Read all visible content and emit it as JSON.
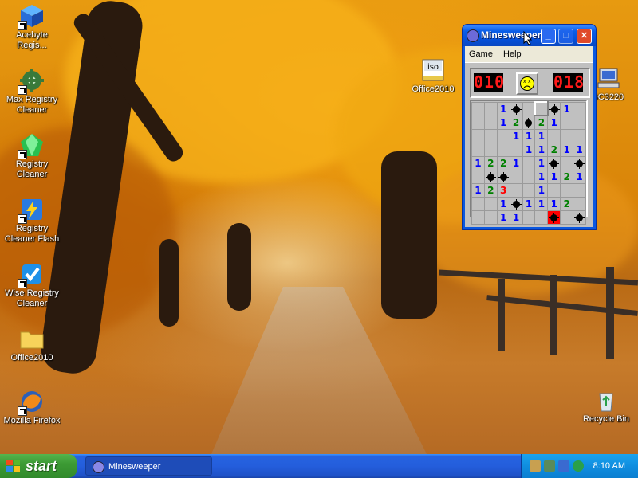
{
  "desktop": {
    "icons": [
      {
        "label": "Acebyte Regis...",
        "icon": "registry-cube-icon"
      },
      {
        "label": "Max Registry Cleaner",
        "icon": "gear-registry-icon"
      },
      {
        "label": "Registry Cleaner",
        "icon": "green-gem-icon"
      },
      {
        "label": "Registry Cleaner Flash",
        "icon": "flash-cube-icon"
      },
      {
        "label": "Wise Registry Cleaner",
        "icon": "wise-registry-icon"
      },
      {
        "label": "Office2010",
        "icon": "folder-icon"
      },
      {
        "label": "Mozilla Firefox",
        "icon": "firefox-icon"
      },
      {
        "label": "Office2010",
        "icon": "iso-file-icon"
      },
      {
        "label": "DC3220",
        "icon": "computer-icon"
      },
      {
        "label": "Recycle Bin",
        "icon": "recycle-bin-icon"
      }
    ]
  },
  "window": {
    "title": "Minesweeper",
    "title_visible": "Minesweeper",
    "menu": [
      "Game",
      "Help"
    ],
    "mines_left": "010",
    "timer": "018",
    "face_state": "dead",
    "rows": [
      "__1M_?M1_",
      "__12M21__",
      "___111___",
      "____11211",
      "1221_1M_M",
      "_MM__1121",
      "123__1___",
      "__1M1112_",
      "__11__X_M"
    ]
  },
  "taskbar": {
    "start_label": "start",
    "task_label": "Minesweeper",
    "clock": "8:10 AM"
  },
  "colors": {
    "taskbar_blue": "#245edc",
    "start_green": "#3c9a34",
    "tray_blue": "#0f8ee0",
    "led_red": "#ff1a1a"
  }
}
